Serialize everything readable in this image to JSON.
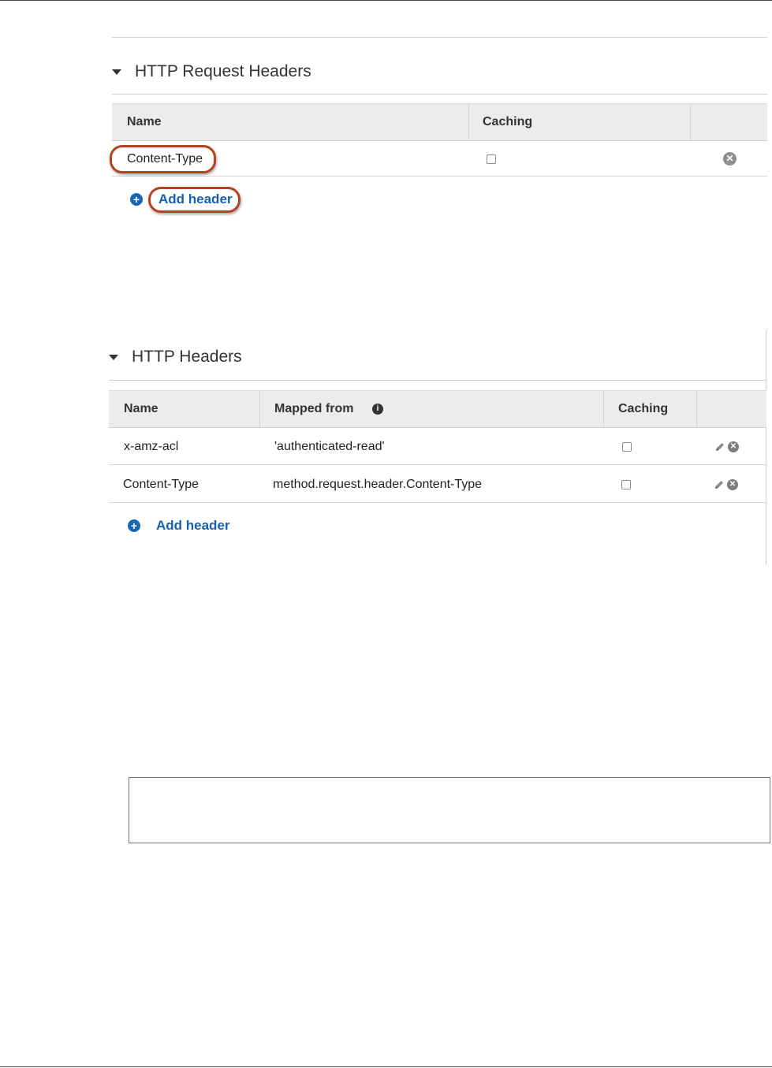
{
  "request_headers": {
    "title": "HTTP Request Headers",
    "columns": [
      "Name",
      "Caching"
    ],
    "rows": [
      {
        "name": "Content-Type",
        "caching": false
      }
    ],
    "add_label": "Add header"
  },
  "integration_headers": {
    "title": "HTTP Headers",
    "columns": [
      "Name",
      "Mapped from",
      "Caching"
    ],
    "rows": [
      {
        "name": "x-amz-acl",
        "mapped_from": "'authenticated-read'",
        "caching": false
      },
      {
        "name": "Content-Type",
        "mapped_from": "method.request.header.Content-Type",
        "caching": false
      }
    ],
    "add_label": "Add header"
  },
  "icons": {
    "expand": "caret-down-icon",
    "remove": "remove-circle-icon",
    "edit": "pencil-icon",
    "add": "plus-circle-icon",
    "info": "info-circle-icon"
  },
  "colors": {
    "link": "#1660b0",
    "highlight": "#b5411e",
    "header_bg": "#ececec"
  }
}
